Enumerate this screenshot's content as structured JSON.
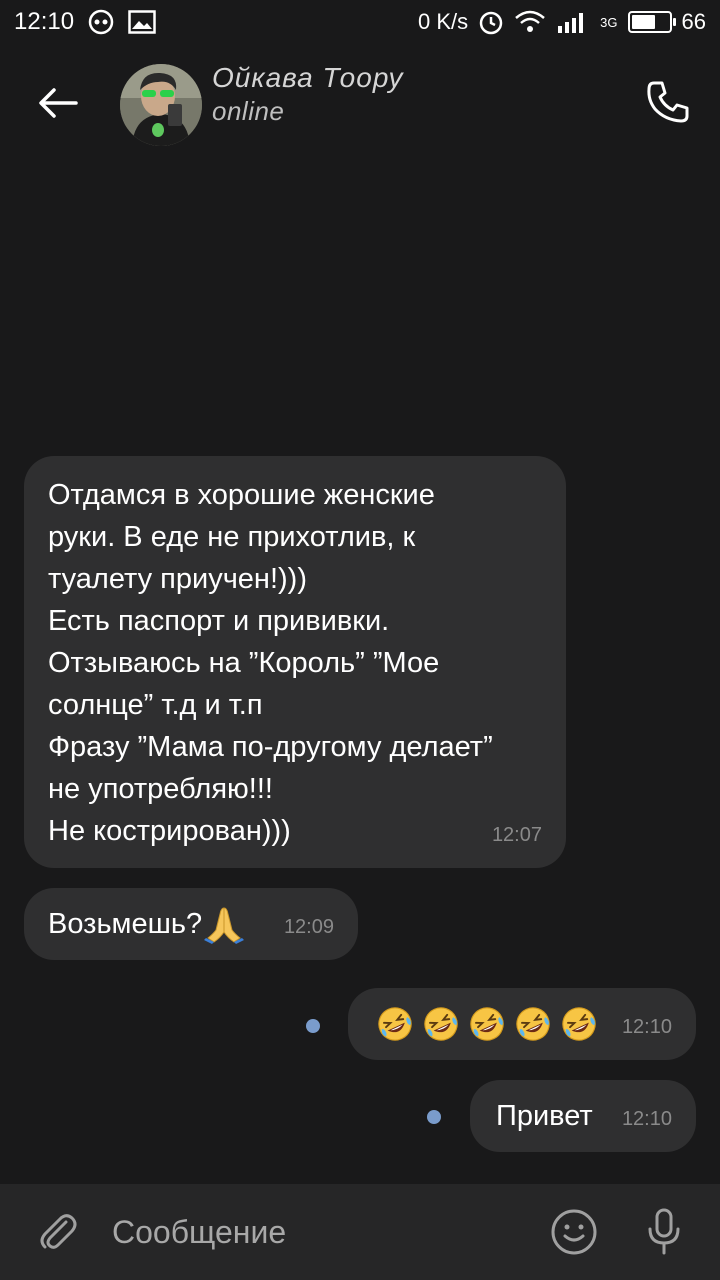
{
  "status_bar": {
    "time": "12:10",
    "net_speed": "0 K/s",
    "network_type": "3G",
    "battery": "66",
    "battery_fraction": 0.66
  },
  "header": {
    "contact_name": "Ойкава Тоору",
    "status": "online"
  },
  "messages": [
    {
      "direction": "incoming",
      "text": "Отдамся в хорошие женские\nруки. В еде не прихотлив, к\nтуалету приучен!)))\nЕсть паспорт и прививки.\nОтзываюсь на ”Король” ”Мое\nсолнце” т.д и т.п\nФразу ”Мама по-другому делает”\nне употребляю!!!\nНе кострирован)))",
      "time": "12:07"
    },
    {
      "direction": "incoming",
      "text": "Возьмешь?",
      "emoji": "folded-hands",
      "time": "12:09"
    },
    {
      "direction": "outgoing",
      "emoji": "rolling-on-floor-laughing",
      "emoji_count": 5,
      "time": "12:10",
      "unread": true
    },
    {
      "direction": "outgoing",
      "text": "Привет",
      "time": "12:10",
      "unread": true
    }
  ],
  "composer": {
    "placeholder": "Сообщение"
  },
  "colors": {
    "background": "#19191a",
    "bubble": "#2f2f30",
    "composer": "#262627",
    "unread_dot": "#7a9ccc"
  }
}
